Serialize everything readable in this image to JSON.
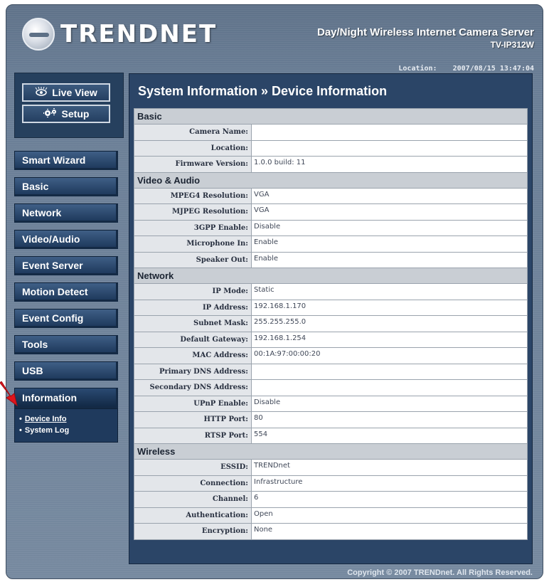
{
  "header": {
    "logo_text": "TRENDNET",
    "product_title": "Day/Night Wireless Internet Camera Server",
    "product_model": "TV-IP312W",
    "location_label": "Location:",
    "datetime": "2007/08/15 13:47:04"
  },
  "view_buttons": {
    "live_view": "Live View",
    "setup": "Setup"
  },
  "menu": [
    "Smart Wizard",
    "Basic",
    "Network",
    "Video/Audio",
    "Event Server",
    "Motion Detect",
    "Event Config",
    "Tools",
    "USB",
    "Information"
  ],
  "submenu": [
    "Device Info",
    "System Log"
  ],
  "main": {
    "title": "System Information » Device Information"
  },
  "sections": [
    {
      "name": "Basic",
      "rows": [
        {
          "label": "Camera Name:",
          "value": ""
        },
        {
          "label": "Location:",
          "value": ""
        },
        {
          "label": "Firmware Version:",
          "value": "1.0.0 build: 11"
        }
      ]
    },
    {
      "name": "Video & Audio",
      "rows": [
        {
          "label": "MPEG4 Resolution:",
          "value": "VGA"
        },
        {
          "label": "MJPEG Resolution:",
          "value": "VGA"
        },
        {
          "label": "3GPP Enable:",
          "value": "Disable"
        },
        {
          "label": "Microphone In:",
          "value": "Enable"
        },
        {
          "label": "Speaker Out:",
          "value": "Enable"
        }
      ]
    },
    {
      "name": "Network",
      "rows": [
        {
          "label": "IP Mode:",
          "value": "Static"
        },
        {
          "label": "IP Address:",
          "value": "192.168.1.170"
        },
        {
          "label": "Subnet Mask:",
          "value": "255.255.255.0"
        },
        {
          "label": "Default Gateway:",
          "value": "192.168.1.254"
        },
        {
          "label": "MAC Address:",
          "value": "00:1A:97:00:00:20"
        },
        {
          "label": "Primary DNS Address:",
          "value": ""
        },
        {
          "label": "Secondary DNS Address:",
          "value": ""
        },
        {
          "label": "UPnP Enable:",
          "value": "Disable"
        },
        {
          "label": "HTTP Port:",
          "value": "80"
        },
        {
          "label": "RTSP Port:",
          "value": "554"
        }
      ]
    },
    {
      "name": "Wireless",
      "rows": [
        {
          "label": "ESSID:",
          "value": "TRENDnet"
        },
        {
          "label": "Connection:",
          "value": "Infrastructure"
        },
        {
          "label": "Channel:",
          "value": "6"
        },
        {
          "label": "Authentication:",
          "value": "Open"
        },
        {
          "label": "Encryption:",
          "value": "None"
        }
      ]
    }
  ],
  "footer": "Copyright © 2007 TRENDnet. All Rights Reserved.",
  "colors": {
    "frame": "#6a7e96",
    "panel": "#2b4567",
    "button": "#2e4d74",
    "arrow": "#e0141b"
  },
  "icons": {
    "live_view": "eye-icon",
    "setup": "gears-icon",
    "pointer": "red-arrow-icon"
  }
}
